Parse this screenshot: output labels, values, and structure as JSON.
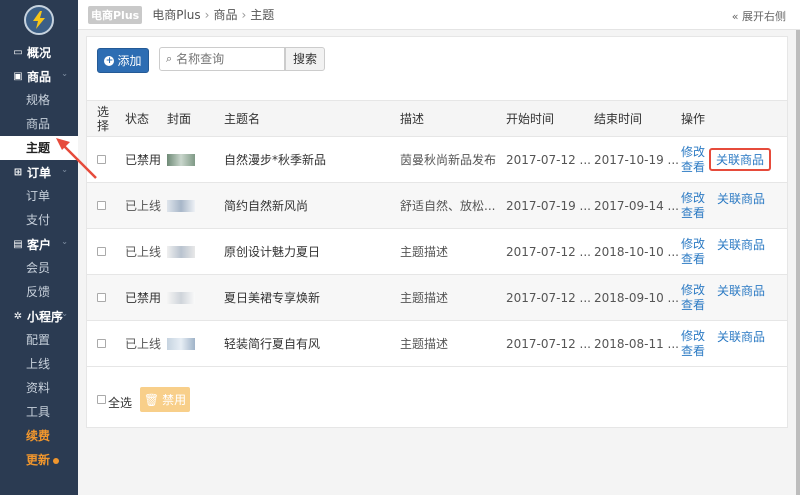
{
  "sidebar": {
    "groups": [
      {
        "label": "概况",
        "icon": "monitor-icon",
        "items": []
      },
      {
        "label": "商品",
        "icon": "bag-icon",
        "items": [
          "规格",
          "商品",
          "主题"
        ]
      },
      {
        "label": "订单",
        "icon": "cart-icon",
        "items": [
          "订单",
          "支付"
        ]
      },
      {
        "label": "客户",
        "icon": "id-card-icon",
        "items": [
          "会员",
          "反馈"
        ]
      },
      {
        "label": "小程序",
        "icon": "gears-icon",
        "items": [
          "配置",
          "上线",
          "资料",
          "工具",
          "续费",
          "更新"
        ]
      }
    ],
    "active_item": "主题"
  },
  "header": {
    "brand": "电商Plus",
    "breadcrumb": [
      "电商Plus",
      "商品",
      "主题"
    ],
    "expand_label": "« 展开右侧"
  },
  "toolbar": {
    "add_label": "添加",
    "search_placeholder": "名称查询",
    "search_label": "搜索"
  },
  "table": {
    "headers": [
      "选择",
      "状态",
      "封面",
      "主题名",
      "描述",
      "开始时间",
      "结束时间",
      "操作"
    ],
    "rows": [
      {
        "status": "已禁用",
        "name": "自然漫步*秋季新品",
        "desc": "茵曼秋尚新品发布",
        "start": "2017-07-12 ...",
        "end": "2017-10-19 ...",
        "op1": "修改",
        "op2": "查看",
        "op3": "关联商品"
      },
      {
        "status": "已上线",
        "name": "简约自然新风尚",
        "desc": "舒适自然、放松...",
        "start": "2017-07-19 ...",
        "end": "2017-09-14 ...",
        "op1": "修改",
        "op2": "查看",
        "op3": "关联商品"
      },
      {
        "status": "已上线",
        "name": "原创设计魅力夏日",
        "desc": "主题描述",
        "start": "2017-07-12 ...",
        "end": "2018-10-10 ...",
        "op1": "修改",
        "op2": "查看",
        "op3": "关联商品"
      },
      {
        "status": "已禁用",
        "name": "夏日美裙专享焕新",
        "desc": "主题描述",
        "start": "2017-07-12 ...",
        "end": "2018-09-10 ...",
        "op1": "修改",
        "op2": "查看",
        "op3": "关联商品"
      },
      {
        "status": "已上线",
        "name": "轻装简行夏自有风",
        "desc": "主题描述",
        "start": "2017-07-12 ...",
        "end": "2018-08-11 ...",
        "op1": "修改",
        "op2": "查看",
        "op3": "关联商品"
      }
    ]
  },
  "footer": {
    "select_all_label": "全选",
    "disable_label": "禁用"
  },
  "colors": {
    "sidebar_bg": "#2b3b52",
    "primary": "#2d6db3",
    "link": "#2d7bc4",
    "warning": "#f8cf8a",
    "highlight": "#e64b3b",
    "accent_orange": "#f0962d"
  }
}
